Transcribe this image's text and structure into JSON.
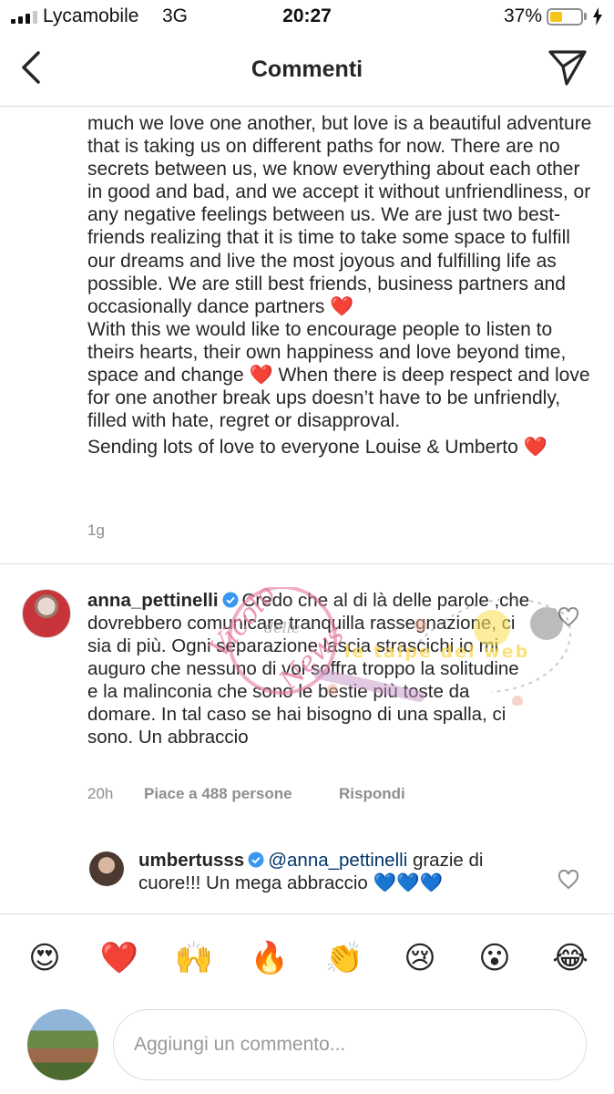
{
  "status": {
    "carrier": "Lycamobile",
    "network": "3G",
    "time": "20:27",
    "battery": "37%",
    "battery_level": 0.37
  },
  "header": {
    "title": "Commenti",
    "back_icon": "chevron-left-icon",
    "send_icon": "paper-plane-icon"
  },
  "caption": {
    "paragraphs": [
      "much we love one another, but love is a beautiful adventure that is taking us on different paths for now. There are no secrets between us, we know everything about each other in good and bad, and we accept it without unfriendliness, or any negative feelings between us. We are just two best-friends realizing that it is time to take some space to fulfill our dreams and live the most joyous and fulfilling life as possible. We are still best friends, business partners and occasionally dance partners ❤️",
      "With this we would like to encourage people to listen to theirs hearts, their own happiness and love beyond time, space and change ❤️ When there is deep respect and love for one another break ups doesn’t have to be unfriendly, filled with hate, regret or disapproval.",
      "Sending lots of love to everyone Louise & Umberto ❤️"
    ],
    "time": "1g"
  },
  "comments": [
    {
      "username": "anna_pettinelli",
      "text": "Credo che al di là delle parole ,che dovrebbero comunicare tranquilla rassegnazione, ci sia di più. Ogni separazione lascia strascichi io mi auguro che nessuno di voi soffra troppo la solitudine e la malinconia che sono le bestie più toste da domare. In tal caso se hai bisogno di una spalla, ci sono. Un abbraccio",
      "time": "20h",
      "likes": "Piace a 488 persone",
      "reply": "Rispondi"
    },
    {
      "username": "umbertusss",
      "mention": "@anna_pettinelli",
      "text": "grazie di cuore!!! Un mega abbraccio 💙💙💙"
    }
  ],
  "emoji_bar": [
    "😍",
    "❤️",
    "🙌",
    "🔥",
    "👏",
    "😢",
    "😮",
    "😂"
  ],
  "composer": {
    "placeholder": "Aggiungi un commento..."
  },
  "watermark": {
    "script_1": "Vicolo",
    "script_2": "delle",
    "script_3": "News",
    "tag": "le talpe del web"
  },
  "colors": {
    "text": "#262626",
    "secondary": "#8e8e8e",
    "heart": "#e0245e",
    "verified": "#3897f0",
    "battery": "#f5c518"
  }
}
